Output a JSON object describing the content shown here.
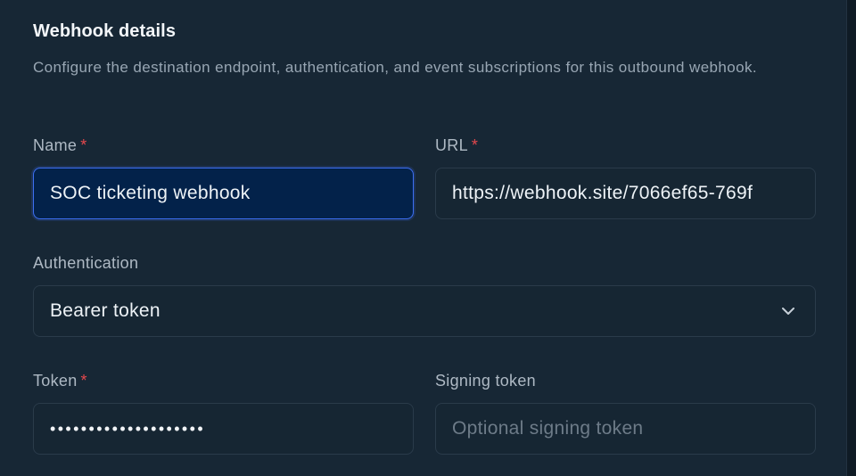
{
  "section": {
    "title": "Webhook details",
    "description": "Configure the destination endpoint, authentication, and event subscriptions for this outbound webhook."
  },
  "fields": {
    "name": {
      "label": "Name",
      "required_mark": "*",
      "value": "SOC ticketing webhook"
    },
    "url": {
      "label": "URL",
      "required_mark": "*",
      "value": "https://webhook.site/7066ef65-769f"
    },
    "authentication": {
      "label": "Authentication",
      "selected": "Bearer token"
    },
    "token": {
      "label": "Token",
      "required_mark": "*",
      "masked_value": "••••••••••••••••••••"
    },
    "signing_token": {
      "label": "Signing token",
      "placeholder": "Optional signing token"
    }
  },
  "colors": {
    "background": "#172735",
    "accent": "#3d6ff2",
    "required": "#e5484d",
    "focused_field_bg": "#03224a"
  },
  "icons": {
    "authentication_dropdown": "chevron-down-icon"
  }
}
